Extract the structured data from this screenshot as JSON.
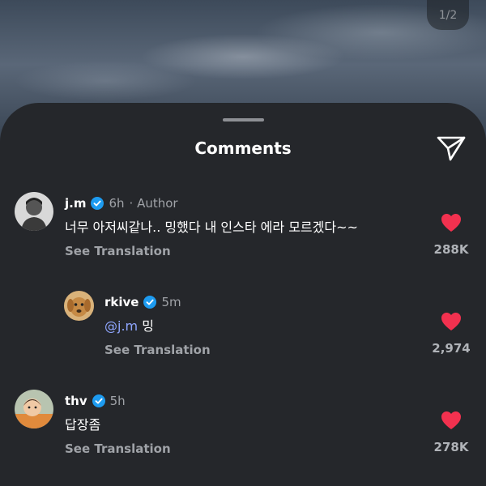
{
  "page_counter": "1/2",
  "sheet": {
    "title": "Comments"
  },
  "comments": [
    {
      "username": "j.m",
      "time": "6h",
      "author_tag": "· Author",
      "text": "너무 아저씨같나.. 밍했다 내 인스타 에라 모르겠다~~",
      "see_translation": "See Translation",
      "likes": "288K",
      "liked": true,
      "avatar_icon": "portrait-bw-icon"
    },
    {
      "username": "rkive",
      "time": "5m",
      "mention": "@j.m",
      "text": "밍",
      "see_translation": "See Translation",
      "likes": "2,974",
      "liked": true,
      "avatar_icon": "dog-avatar-icon"
    },
    {
      "username": "thv",
      "time": "5h",
      "text": "답장좀",
      "see_translation": "See Translation",
      "likes": "278K",
      "liked": true,
      "avatar_icon": "child-photo-avatar-icon"
    }
  ],
  "colors": {
    "sheet_bg": "#25272b",
    "heart": "#f2314f",
    "verified": "#1d9bf0",
    "mention": "#8fa6ff"
  }
}
